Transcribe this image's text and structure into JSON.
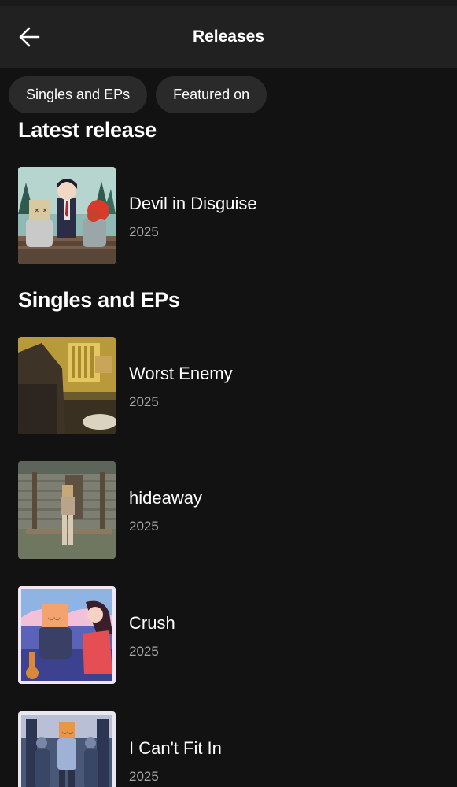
{
  "header": {
    "title": "Releases",
    "back_icon": "arrow-left-icon"
  },
  "filters": [
    {
      "label": "Singles and EPs"
    },
    {
      "label": "Featured on"
    }
  ],
  "sections": {
    "latest": {
      "heading": "Latest release",
      "items": [
        {
          "title": "Devil in Disguise",
          "year": "2025",
          "cover": "cover-devil-in-disguise"
        }
      ]
    },
    "singles": {
      "heading": "Singles and EPs",
      "items": [
        {
          "title": "Worst Enemy",
          "year": "2025",
          "cover": "cover-worst-enemy"
        },
        {
          "title": "hideaway",
          "year": "2025",
          "cover": "cover-hideaway"
        },
        {
          "title": "Crush",
          "year": "2025",
          "cover": "cover-crush"
        },
        {
          "title": "I Can't Fit In",
          "year": "2025",
          "cover": "cover-i-cant-fit-in"
        }
      ]
    }
  },
  "colors": {
    "background": "#121212",
    "topbar": "#212121",
    "chip": "#2a2a2a",
    "secondary_text": "#a7a7a7"
  }
}
